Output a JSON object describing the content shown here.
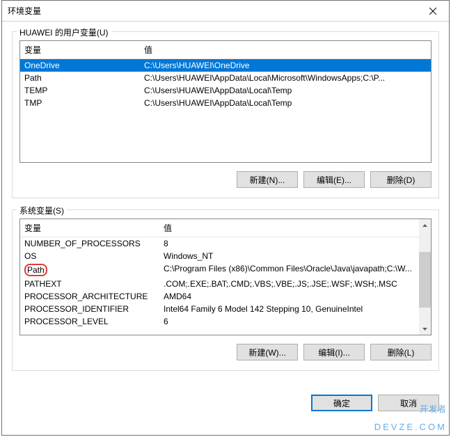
{
  "dialog": {
    "title": "环境变量"
  },
  "user_vars": {
    "group_label": "HUAWEI 的用户变量(U)",
    "header_var": "变量",
    "header_val": "值",
    "rows": [
      {
        "name": "OneDrive",
        "value": "C:\\Users\\HUAWEI\\OneDrive"
      },
      {
        "name": "Path",
        "value": "C:\\Users\\HUAWEI\\AppData\\Local\\Microsoft\\WindowsApps;C:\\P..."
      },
      {
        "name": "TEMP",
        "value": "C:\\Users\\HUAWEI\\AppData\\Local\\Temp"
      },
      {
        "name": "TMP",
        "value": "C:\\Users\\HUAWEI\\AppData\\Local\\Temp"
      }
    ],
    "btn_new": "新建(N)...",
    "btn_edit": "编辑(E)...",
    "btn_delete": "删除(D)"
  },
  "sys_vars": {
    "group_label": "系统变量(S)",
    "header_var": "变量",
    "header_val": "值",
    "rows": [
      {
        "name": "NUMBER_OF_PROCESSORS",
        "value": "8"
      },
      {
        "name": "OS",
        "value": "Windows_NT"
      },
      {
        "name": "Path",
        "value": "C:\\Program Files (x86)\\Common Files\\Oracle\\Java\\javapath;C:\\W..."
      },
      {
        "name": "PATHEXT",
        "value": ".COM;.EXE;.BAT;.CMD;.VBS;.VBE;.JS;.JSE;.WSF;.WSH;.MSC"
      },
      {
        "name": "PROCESSOR_ARCHITECTURE",
        "value": "AMD64"
      },
      {
        "name": "PROCESSOR_IDENTIFIER",
        "value": "Intel64 Family 6 Model 142 Stepping 10, GenuineIntel"
      },
      {
        "name": "PROCESSOR_LEVEL",
        "value": "6"
      }
    ],
    "btn_new": "新建(W)...",
    "btn_edit": "编辑(I)...",
    "btn_delete": "删除(L)"
  },
  "footer": {
    "ok": "确定",
    "cancel": "取消"
  },
  "watermark": {
    "main": "开发者",
    "sub": "DEVZE.COM"
  }
}
